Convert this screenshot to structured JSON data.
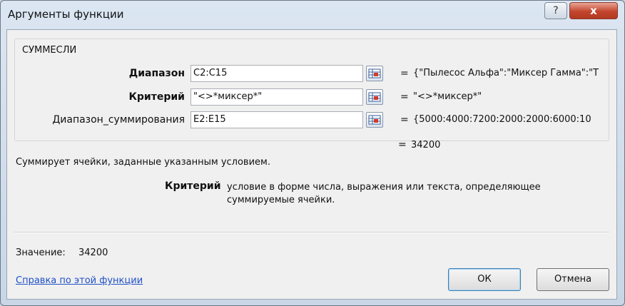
{
  "window": {
    "title": "Аргументы функции",
    "help_glyph": "?",
    "close_glyph": "x"
  },
  "function_name": "СУММЕСЛИ",
  "arguments": [
    {
      "label": "Диапазон",
      "bold": true,
      "value": "C2:C15",
      "result": "{\"Пылесос Альфа\":\"Миксер Гамма\":\"Т"
    },
    {
      "label": "Критерий",
      "bold": true,
      "value": "\"<>*миксер*\"",
      "result": "\"<>*миксер*\""
    },
    {
      "label": "Диапазон_суммирования",
      "bold": false,
      "value": "E2:E15",
      "result": "{5000:4000:7200:2000:2000:6000:10"
    }
  ],
  "equals_sign": "=",
  "formula_result": "34200",
  "description": "Суммирует ячейки, заданные указанным условием.",
  "argument_help": {
    "name": "Критерий",
    "text_line1": "условие в форме числа, выражения или текста, определяющее",
    "text_line2": "суммируемые ячейки."
  },
  "value_label": "Значение:",
  "value": "34200",
  "help_link": "Справка по этой функции",
  "buttons": {
    "ok": "ОК",
    "cancel": "Отмена"
  },
  "icons": {
    "ref": "range-select-icon"
  }
}
